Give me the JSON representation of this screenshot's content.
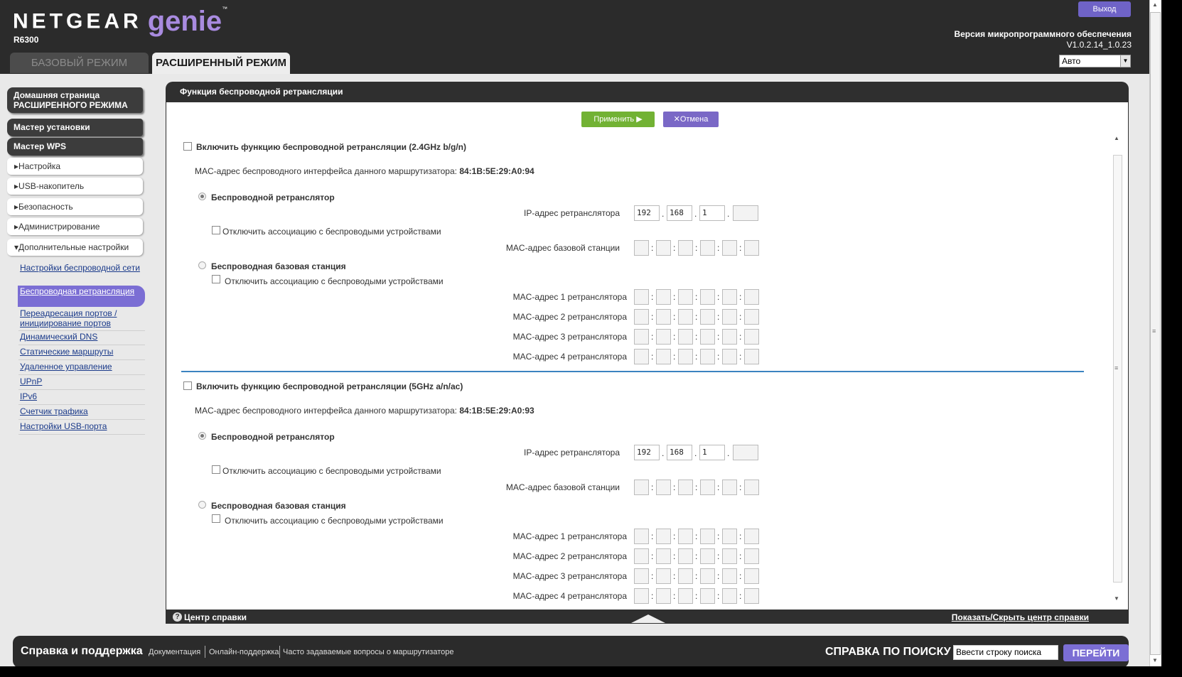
{
  "header": {
    "brand_name": "NETGEAR",
    "brand_product": "genie",
    "brand_tm": "™",
    "model": "R6300",
    "tabs": [
      "БАЗОВЫЙ РЕЖИМ",
      "РАСШИРЕННЫЙ РЕЖИМ"
    ],
    "active_tab": "РАСШИРЕННЫЙ РЕЖИМ",
    "logout_label": "Выход",
    "firmware_label": "Версия микропрограммного обеспечения",
    "firmware_version": "V1.0.2.14_1.0.23",
    "language_value": "Авто",
    "colors": {
      "header_bg": "#2b2b2b",
      "accent": "#7b6ed4"
    }
  },
  "sidebar": {
    "advanced_home": "Домашняя страница РАСШИРЕННОГО РЕЖИМА",
    "setup_wizard": "Мастер установки",
    "wps_wizard": "Мастер WPS",
    "expand_marker": "▸",
    "expanded_marker": "▾",
    "menus": [
      "Настройка",
      "USB-накопитель",
      "Безопасность",
      "Администрирование",
      "Дополнительные настройки"
    ],
    "submenu": [
      "Настройки беспроводной сети",
      "Беспроводная ретрансляция",
      "Переадресация портов / инициирование портов",
      "Динамический DNS",
      "Статические маршруты",
      "Удаленное управление",
      "UPnP",
      "IPv6",
      "Счетчик трафика",
      "Настройки USB-порта"
    ],
    "active_submenu": "Беспроводная ретрансляция"
  },
  "main": {
    "title": "Функция беспроводной ретрансляции",
    "apply_label": "Применить",
    "apply_icon": "▶",
    "cancel_label": "Отмена",
    "cancel_icon": "✕",
    "colors": {
      "apply": "#72b234",
      "cancel": "#7a68c6",
      "divider": "#3b83c0"
    },
    "bands": [
      {
        "enable_label": "Включить функцию беспроводной ретрансляции (2.4GHz b/g/n)",
        "enabled": false,
        "mac_label": "MAC-адрес беспроводного интерфейса данного маршрутизатора:",
        "mac_value": "84:1B:5E:29:A0:94",
        "repeater_label": "Беспроводной ретранслятор",
        "repeater_selected": true,
        "ip_label": "IP-адрес ретранслятора",
        "ip": [
          "192",
          "168",
          "1",
          ""
        ],
        "disable_assoc_label": "Отключить ассоциацию с беспроводыми устройствами",
        "base_mac_label": "MAC-адрес базовой станции",
        "base_station_label": "Беспроводная базовая станция",
        "base_station_selected": false,
        "base_disable_assoc_label": "Отключить ассоциацию с беспроводыми устройствами",
        "repeater_macs": [
          "MAC-адрес 1 ретранслятора",
          "MAC-адрес 2 ретранслятора",
          "MAC-адрес 3 ретранслятора",
          "MAC-адрес 4 ретранслятора"
        ]
      },
      {
        "enable_label": "Включить функцию беспроводной ретрансляции (5GHz a/n/ac)",
        "enabled": false,
        "mac_label": "MAC-адрес беспроводного интерфейса данного маршрутизатора:",
        "mac_value": "84:1B:5E:29:A0:93",
        "repeater_label": "Беспроводной ретранслятор",
        "repeater_selected": true,
        "ip_label": "IP-адрес ретранслятора",
        "ip": [
          "192",
          "168",
          "1",
          ""
        ],
        "disable_assoc_label": "Отключить ассоциацию с беспроводыми устройствами",
        "base_mac_label": "MAC-адрес базовой станции",
        "base_station_label": "Беспроводная базовая станция",
        "base_station_selected": false,
        "base_disable_assoc_label": "Отключить ассоциацию с беспроводыми устройствами",
        "repeater_macs": [
          "MAC-адрес 1 ретранслятора",
          "MAC-адрес 2 ретранслятора",
          "MAC-адрес 3 ретранслятора",
          "MAC-адрес 4 ретранслятора"
        ]
      }
    ],
    "ip_separator": ".",
    "mac_separator": ":"
  },
  "help_bar": {
    "icon": "?",
    "label": "Центр справки",
    "toggle_label": "Показать/Скрыть центр справки"
  },
  "footer": {
    "support_title": "Справка и поддержка",
    "links": [
      "Документация",
      "Онлайн-поддержка",
      "Часто задаваемые вопросы о маршрутизаторе"
    ],
    "search_title": "СПРАВКА ПО ПОИСКУ",
    "search_placeholder": "Ввести строку поиска",
    "go_label": "ПЕРЕЙТИ"
  },
  "scroll_glyphs": {
    "up": "▲",
    "down": "▼",
    "grip": "≡"
  }
}
